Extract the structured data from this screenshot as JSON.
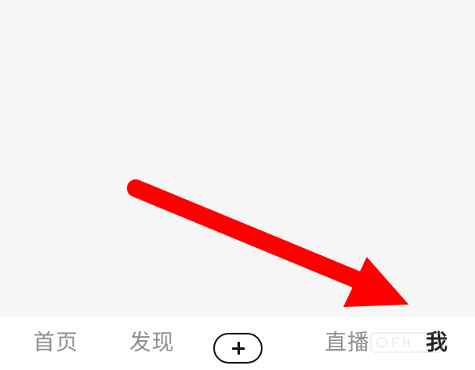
{
  "tabs": {
    "home": "首页",
    "discover": "发现",
    "live": "直播",
    "me": "我"
  },
  "icons": {
    "create": "plus-icon"
  },
  "colors": {
    "background": "#f6f6f6",
    "tab_inactive": "#8e8e8e",
    "tab_active": "#222222",
    "annotation": "#ff0000"
  }
}
